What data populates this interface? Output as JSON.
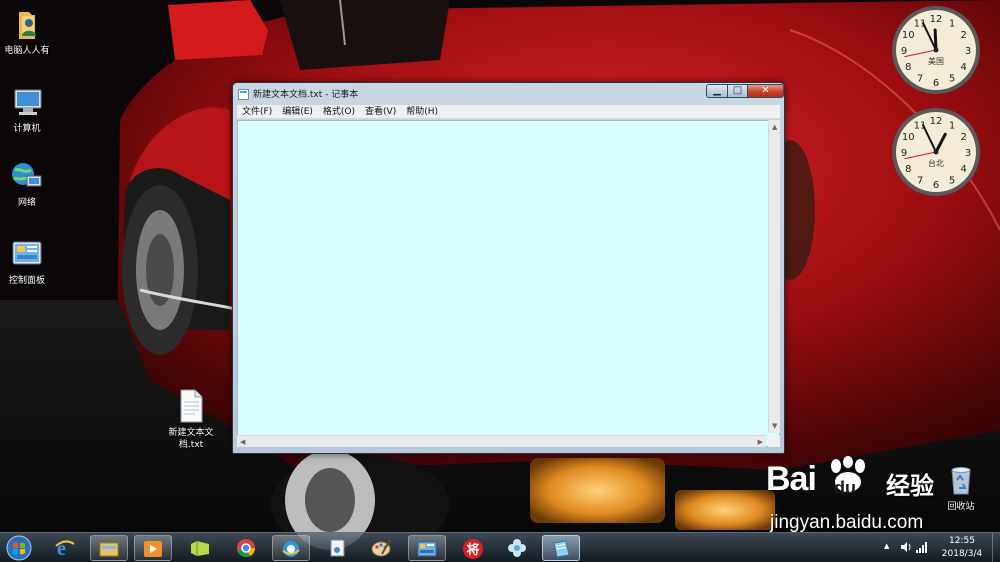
{
  "desktop": {
    "icons": [
      {
        "label": "电脑人人有",
        "icon": "folder-user-icon"
      },
      {
        "label": "计算机",
        "icon": "computer-icon"
      },
      {
        "label": "网络",
        "icon": "network-icon"
      },
      {
        "label": "控制面板",
        "icon": "control-panel-icon"
      },
      {
        "label": "新建文本文\n档.txt",
        "icon": "text-file-icon"
      },
      {
        "label": "回收站",
        "icon": "recycle-bin-icon"
      }
    ]
  },
  "notepad": {
    "title": "新建文本文档.txt - 记事本",
    "menu": [
      "文件(F)",
      "编辑(E)",
      "格式(O)",
      "查看(V)",
      "帮助(H)"
    ],
    "content": "",
    "background_color": "#d9fcfc",
    "controls": {
      "minimize": "▁",
      "maximize": "□",
      "close": "✕"
    }
  },
  "gadgets": {
    "clocks": [
      {
        "label": "美国",
        "hour": 11,
        "minute": 55,
        "second": 43
      },
      {
        "label": "台北",
        "hour": 12,
        "minute": 55,
        "second": 43
      }
    ]
  },
  "watermark": {
    "brand": "Bai",
    "brand_suffix": "du",
    "brand_cn": "经验",
    "url": "jingyan.baidu.com"
  },
  "taskbar": {
    "items": [
      {
        "name": "ie-icon",
        "state": "pinned"
      },
      {
        "name": "file-explorer-icon",
        "state": "open"
      },
      {
        "name": "media-player-icon",
        "state": "open"
      },
      {
        "name": "folder-icon",
        "state": "pinned"
      },
      {
        "name": "chrome-icon",
        "state": "pinned"
      },
      {
        "name": "qq-browser-icon",
        "state": "open"
      },
      {
        "name": "document-icon",
        "state": "pinned"
      },
      {
        "name": "paint-icon",
        "state": "pinned"
      },
      {
        "name": "control-panel-icon",
        "state": "open"
      },
      {
        "name": "jiang-app-icon",
        "state": "pinned",
        "text": "将"
      },
      {
        "name": "flower-icon",
        "state": "pinned"
      },
      {
        "name": "notepad-icon",
        "state": "active"
      }
    ],
    "tray": {
      "time": "12:55",
      "date": "2018/3/4",
      "expand_label": "▲"
    }
  }
}
